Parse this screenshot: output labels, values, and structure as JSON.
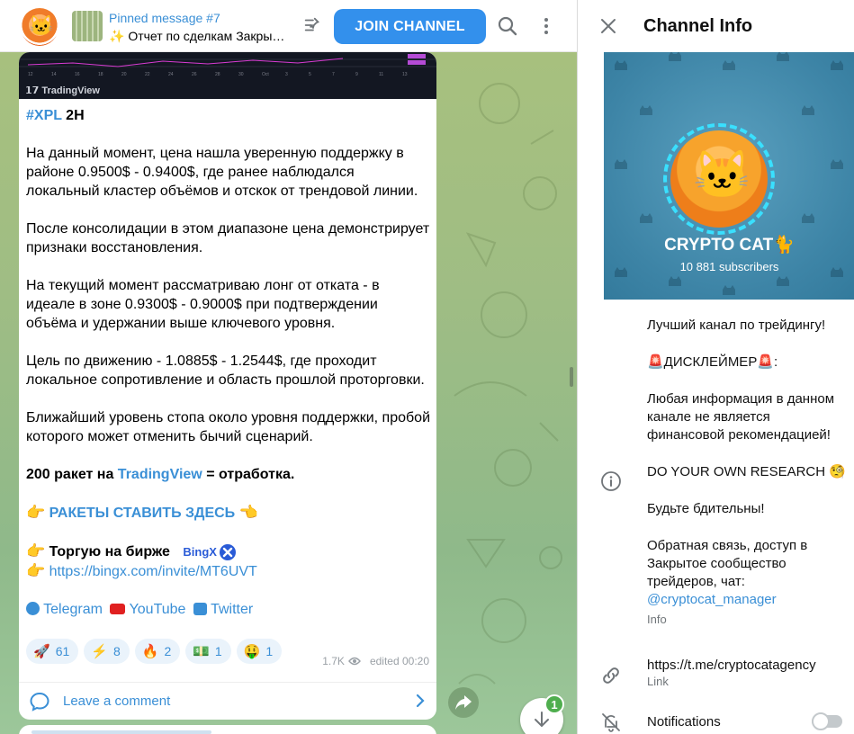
{
  "topbar": {
    "pinned_title": "Pinned message #7",
    "pinned_text": "✨ Отчет по сделкам Закры…",
    "join_label": "JOIN CHANNEL"
  },
  "chart_image": {
    "brand": "TradingView"
  },
  "message": {
    "hashtag": "#XPL",
    "timeframe": " 2H",
    "p1": "На данный момент, цена нашла уверенную поддержку в районе 0.9500$ - 0.9400$, где ранее наблюдался локальный кластер объёмов и отскок от трендовой линии.",
    "p2": "После консолидации в этом диапазоне цена демонстрирует признаки восстановления.",
    "p3": "На текущий момент рассматриваю лонг от отката - в идеале в зоне 0.9300$ - 0.9000$ при подтверждении объёма и удержании выше ключевого уровня.",
    "p4": "Цель по движению - 1.0885$ - 1.2544$, где проходит локальное сопротивление и область прошлой проторговки.",
    "p5": "Ближайший уровень стопа около уровня поддержки, пробой которого может отменить бычий сценарий.",
    "rockets_prefix": "200 ракет на ",
    "rockets_link": "TradingView",
    "rockets_suffix": " = отработка.",
    "cta_hand_left": "👉",
    "cta_link": "РАКЕТЫ СТАВИТЬ ЗДЕСЬ",
    "cta_hand_right": "👈",
    "exchange_hand": "👉",
    "exchange_label": "Торгую на бирже",
    "exchange_logo": "BingX",
    "ref_hand": "👉",
    "ref_link": "https://bingx.com/invite/MT6UVT",
    "social_telegram": "Telegram",
    "social_youtube": "YouTube",
    "social_twitter": "Twitter"
  },
  "reactions": [
    {
      "emoji": "🚀",
      "count": "61"
    },
    {
      "emoji": "⚡",
      "count": "8"
    },
    {
      "emoji": "🔥",
      "count": "2"
    },
    {
      "emoji": "💵",
      "count": "1"
    },
    {
      "emoji": "🤑",
      "count": "1"
    }
  ],
  "meta": {
    "views": "1.7K",
    "edited": "edited 00:20"
  },
  "comment": {
    "label": "Leave a comment"
  },
  "scroll_badge": "1",
  "info": {
    "title": "Channel Info",
    "channel_name": "CRYPTO CAT🐈",
    "subscribers": "10 881 subscribers",
    "desc_line1": "Лучший канал по трейдингу!",
    "disclaimer": "🚨ДИСКЛЕЙМЕР🚨:",
    "desc_line2": "Любая информация в данном канале не является финансовой рекомендацией!",
    "desc_line3": "DO YOUR OWN RESEARCH 🧐",
    "desc_line4": "Будьте бдительны!",
    "desc_line5": "Обратная связь, доступ в Закрытое сообщество трейдеров, чат:",
    "handle": "@cryptocat_manager",
    "info_label": "Info",
    "link": "https://t.me/cryptocatagency",
    "link_label": "Link",
    "notifications_label": "Notifications",
    "notifications_on": false
  },
  "colors": {
    "accent": "#3390ec",
    "link": "#3a8fd6",
    "badge": "#4fae4e",
    "cover": "#3d84a6"
  }
}
